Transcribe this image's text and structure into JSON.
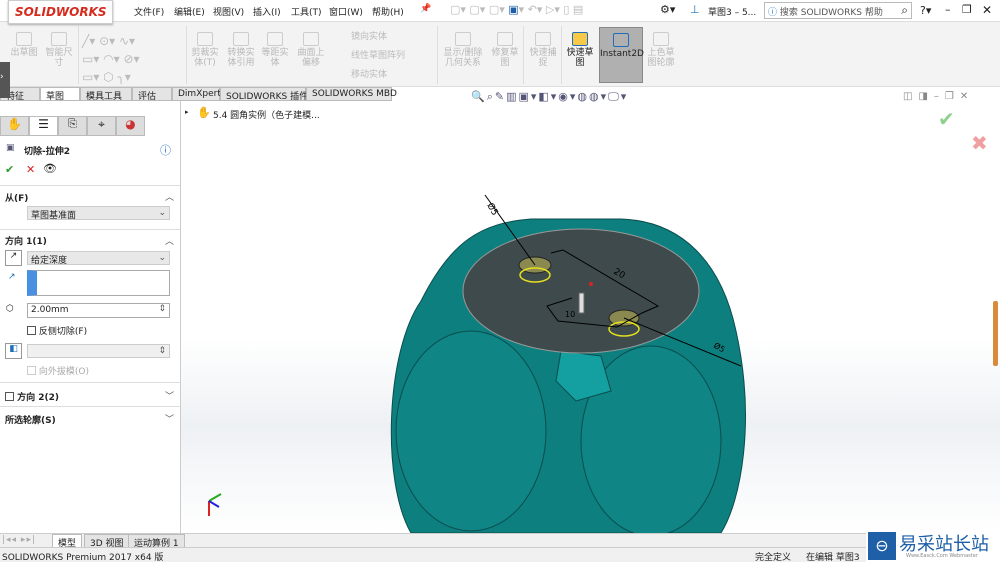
{
  "app": {
    "logo": "SOLIDWORKS",
    "window_title": "草图3 – 5...",
    "search_placeholder": "搜索 SOLIDWORKS 帮助"
  },
  "menu": [
    "文件(F)",
    "编辑(E)",
    "视图(V)",
    "插入(I)",
    "工具(T)",
    "窗口(W)",
    "帮助(H)"
  ],
  "ribbon": {
    "buttons": [
      "出草图",
      "智能尺寸",
      "剪裁实体(T)",
      "转换实体引用",
      "等距实体",
      "曲面上偏移",
      "显示/删除几何关系",
      "修复草图",
      "快速捕捉",
      "快速草图",
      "Instant2D",
      "上色草图轮廓"
    ],
    "small": [
      "镜向实体",
      "线性草图阵列",
      "移动实体"
    ],
    "active": "Instant2D"
  },
  "tabs": [
    "特征",
    "草图",
    "模具工具",
    "评估",
    "DimXpert",
    "SOLIDWORKS 插件",
    "SOLIDWORKS MBD"
  ],
  "active_tab": "草图",
  "tree": {
    "node": "5.4 圆角实例（色子建模..."
  },
  "property": {
    "title": "切除-拉伸2",
    "from": {
      "label": "从(F)",
      "value": "草图基准面"
    },
    "dir1": {
      "label": "方向 1(1)",
      "type": "给定深度",
      "depth": "2.00mm",
      "flip": "反侧切除(F)",
      "draft": "向外拔模(O)"
    },
    "dir2": {
      "label": "方向 2(2)"
    },
    "contours": {
      "label": "所选轮廓(S)"
    }
  },
  "dimensions": {
    "dia1": "Ø5",
    "len1": "20",
    "len2": "10",
    "dia2": "Ø5"
  },
  "bottom_tabs": [
    "模型",
    "3D 视图",
    "运动算例 1"
  ],
  "status": {
    "left": "SOLIDWORKS Premium 2017 x64 版",
    "defined": "完全定义",
    "editing": "在编辑 草图3"
  },
  "watermark": {
    "text": "易采站长站",
    "sub": "Www.Easck.Com Webmaster"
  },
  "colors": {
    "model": "#0e7f7f",
    "face": "#3f4a4c",
    "brand": "#d52b1e",
    "accent": "#1e6fb8"
  }
}
